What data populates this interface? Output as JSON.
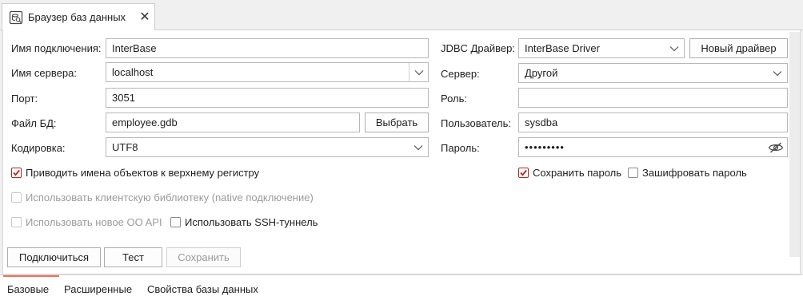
{
  "tab": {
    "title": "Браузер баз данных",
    "icon": "database-browser-icon",
    "close": "✕"
  },
  "left": {
    "connection_name": {
      "label": "Имя подключения:",
      "value": "InterBase"
    },
    "server_name": {
      "label": "Имя сервера:",
      "value": "localhost"
    },
    "port": {
      "label": "Порт:",
      "value": "3051"
    },
    "db_file": {
      "label": "Файл БД:",
      "value": "employee.gdb",
      "browse": "Выбрать"
    },
    "encoding": {
      "label": "Кодировка:",
      "value": "UTF8"
    }
  },
  "right": {
    "jdbc_driver": {
      "label": "JDBC Драйвер:",
      "value": "InterBase Driver",
      "new_driver": "Новый драйвер"
    },
    "server": {
      "label": "Сервер:",
      "value": "Другой"
    },
    "role": {
      "label": "Роль:",
      "value": ""
    },
    "user": {
      "label": "Пользователь:",
      "value": "sysdba"
    },
    "password": {
      "label": "Пароль:",
      "value": "•••••••••"
    }
  },
  "options": {
    "uppercase_names": {
      "label": "Приводить имена объектов к верхнему регистру",
      "checked": true,
      "enabled": true
    },
    "native_library": {
      "label": "Использовать клиентскую библиотеку (native подключение)",
      "checked": false,
      "enabled": false
    },
    "new_oo_api": {
      "label": "Использовать новое OO API",
      "checked": false,
      "enabled": false
    },
    "ssh_tunnel": {
      "label": "Использовать SSH-туннель",
      "checked": false,
      "enabled": true
    },
    "save_password": {
      "label": "Сохранить пароль",
      "checked": true,
      "enabled": true
    },
    "encrypt_password": {
      "label": "Зашифровать пароль",
      "checked": false,
      "enabled": true
    }
  },
  "actions": {
    "connect": "Подключиться",
    "test": "Тест",
    "save": "Сохранить"
  },
  "bottom_tabs": [
    "Базовые",
    "Расширенные",
    "Свойства базы данных"
  ],
  "colors": {
    "check_accent": "#b5261e",
    "active_tab_accent": "#e8735c"
  }
}
